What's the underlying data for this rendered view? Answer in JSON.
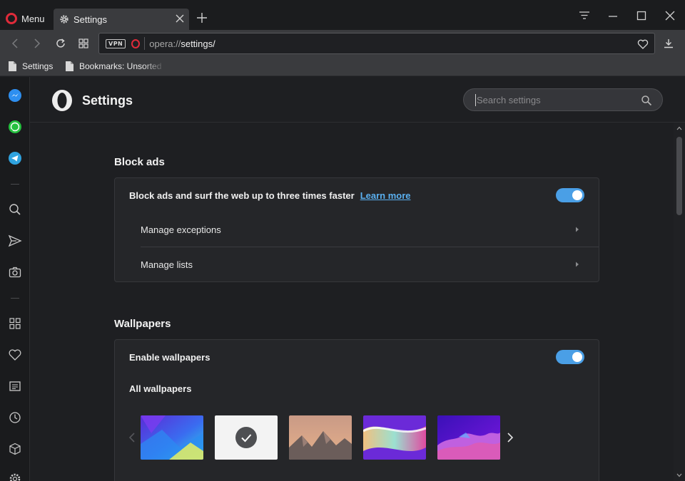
{
  "titlebar": {
    "menu_label": "Menu",
    "tab_title": "Settings"
  },
  "address_bar": {
    "vpn_badge": "VPN",
    "url_scheme": "opera://",
    "url_path": "settings/"
  },
  "bookmarks_bar": {
    "items": [
      {
        "label": "Settings"
      },
      {
        "label": "Bookmarks: Unsorted"
      }
    ]
  },
  "sidebar": {
    "icons": [
      "messenger-icon",
      "whatsapp-icon",
      "telegram-icon",
      "search-icon",
      "send-icon",
      "camera-icon",
      "speed-dial-icon",
      "heart-icon",
      "news-icon",
      "history-icon",
      "extensions-icon",
      "settings-icon"
    ]
  },
  "header": {
    "title": "Settings",
    "search_placeholder": "Search settings"
  },
  "block_ads": {
    "section_title": "Block ads",
    "main_label": "Block ads and surf the web up to three times faster",
    "learn_more": "Learn more",
    "enabled": true,
    "rows": [
      "Manage exceptions",
      "Manage lists"
    ]
  },
  "wallpapers": {
    "section_title": "Wallpapers",
    "enable_label": "Enable wallpapers",
    "enabled": true,
    "all_label": "All wallpapers",
    "selected_index": 1
  },
  "colors": {
    "accent": "#4a9fe6",
    "link": "#5ab0f0",
    "opera_red": "#e02b3a"
  }
}
